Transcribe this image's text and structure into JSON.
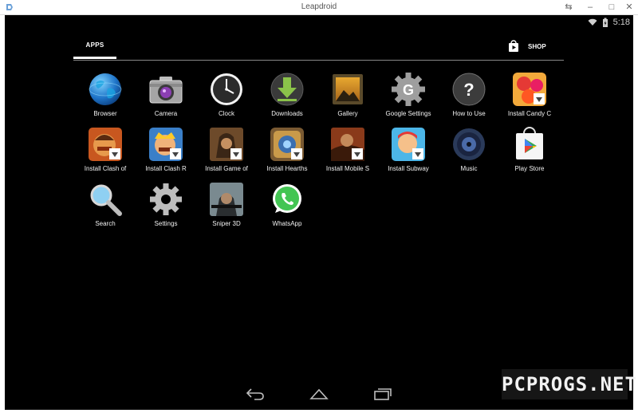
{
  "window": {
    "title": "Leapdroid",
    "buttons": {
      "expand": "⇆",
      "minimize": "–",
      "maximize": "□",
      "close": "✕"
    }
  },
  "status": {
    "time": "5:18"
  },
  "tabs": {
    "apps": "APPS",
    "shop": "SHOP"
  },
  "apps": [
    {
      "label": "Browser",
      "icon": "browser-icon"
    },
    {
      "label": "Camera",
      "icon": "camera-icon"
    },
    {
      "label": "Clock",
      "icon": "clock-icon"
    },
    {
      "label": "Downloads",
      "icon": "downloads-icon"
    },
    {
      "label": "Gallery",
      "icon": "gallery-icon"
    },
    {
      "label": "Google Settings",
      "icon": "google-settings-icon"
    },
    {
      "label": "How to Use",
      "icon": "help-icon"
    },
    {
      "label": "Install Candy C",
      "icon": "candy-crush-icon"
    },
    {
      "label": "Install Clash of",
      "icon": "clash-of-clans-icon"
    },
    {
      "label": "Install Clash R",
      "icon": "clash-royale-icon"
    },
    {
      "label": "Install Game of",
      "icon": "game-of-war-icon"
    },
    {
      "label": "Install Hearths",
      "icon": "hearthstone-icon"
    },
    {
      "label": "Install Mobile S",
      "icon": "mobile-strike-icon"
    },
    {
      "label": "Install Subway",
      "icon": "subway-surfers-icon"
    },
    {
      "label": "Music",
      "icon": "music-icon"
    },
    {
      "label": "Play Store",
      "icon": "play-store-icon"
    },
    {
      "label": "Search",
      "icon": "search-icon"
    },
    {
      "label": "Settings",
      "icon": "gear-icon"
    },
    {
      "label": "Sniper 3D",
      "icon": "sniper-3d-icon"
    },
    {
      "label": "WhatsApp",
      "icon": "whatsapp-icon"
    }
  ],
  "watermark": "PCPROGS.NET"
}
